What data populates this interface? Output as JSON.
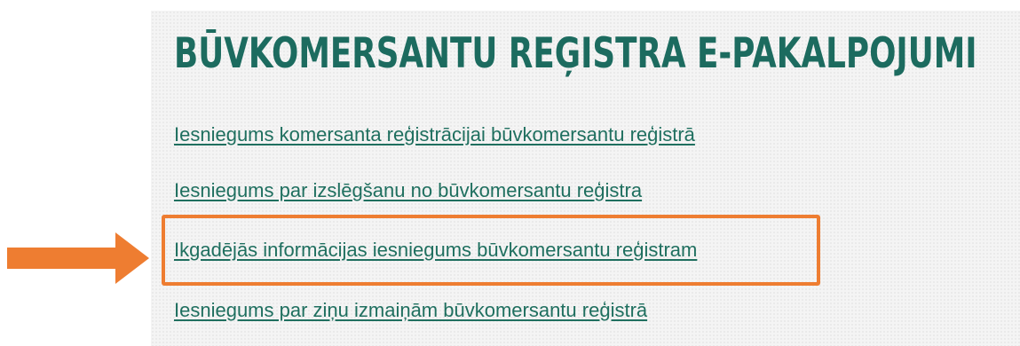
{
  "page": {
    "title": "BŪVKOMERSANTU REĢISTRA E-PAKALPOJUMI"
  },
  "links": [
    {
      "label": "Iesniegums komersanta reģistrācijai būvkomersantu reģistrā"
    },
    {
      "label": "Iesniegums par izslēgšanu no būvkomersantu reģistra"
    },
    {
      "label": "Ikgadējās informācijas iesniegums būvkomersantu reģistram"
    },
    {
      "label": "Iesniegums par ziņu izmaiņām būvkomersantu reģistrā"
    }
  ],
  "annotation": {
    "highlighted_item": "Ikgadējās informācijas iesniegums būvkomersantu reģistram",
    "highlight_color": "#ee7d31"
  },
  "colors": {
    "title": "#1c6b5f",
    "link": "#1f6f5f",
    "accent": "#ee7d31"
  },
  "icons": {
    "pointer": "arrow-right-icon"
  }
}
